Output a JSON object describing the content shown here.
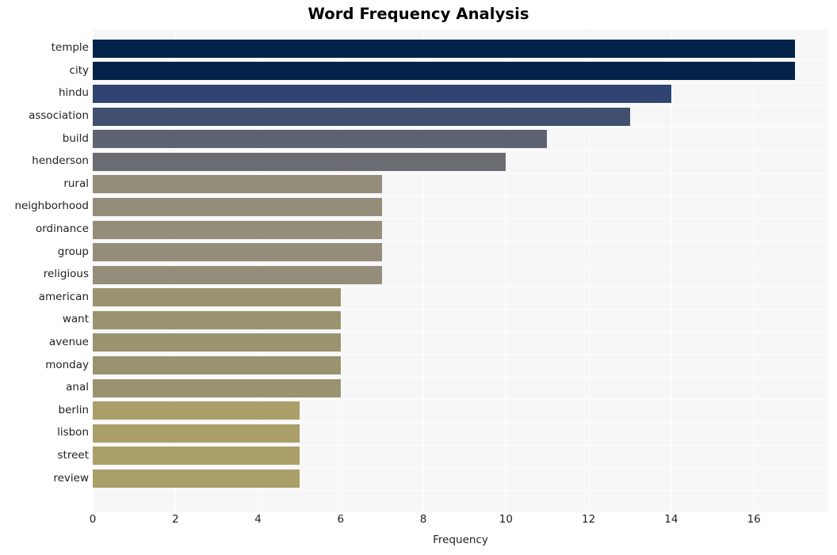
{
  "chart_data": {
    "type": "bar",
    "orientation": "horizontal",
    "title": "Word Frequency Analysis",
    "xlabel": "Frequency",
    "ylabel": "",
    "categories": [
      "temple",
      "city",
      "hindu",
      "association",
      "build",
      "henderson",
      "rural",
      "neighborhood",
      "ordinance",
      "group",
      "religious",
      "american",
      "want",
      "avenue",
      "monday",
      "anal",
      "berlin",
      "lisbon",
      "street",
      "review"
    ],
    "values": [
      17,
      17,
      14,
      13,
      11,
      10,
      7,
      7,
      7,
      7,
      7,
      6,
      6,
      6,
      6,
      6,
      5,
      5,
      5,
      5
    ],
    "bar_colors": [
      "#04234a",
      "#04234a",
      "#2f4470",
      "#41506e",
      "#5e6273",
      "#6b6b72",
      "#938d79",
      "#938d79",
      "#938d79",
      "#938d79",
      "#938d79",
      "#9a9370",
      "#9a9370",
      "#9a9370",
      "#9a9370",
      "#9a9370",
      "#aa9f68",
      "#aa9f68",
      "#aa9f68",
      "#aa9f68"
    ],
    "xlim": [
      0,
      17.8
    ],
    "xticks": [
      0,
      2,
      4,
      6,
      8,
      10,
      12,
      14,
      16
    ],
    "xtick_labels": [
      "0",
      "2",
      "4",
      "6",
      "8",
      "10",
      "12",
      "14",
      "16"
    ],
    "grid": true,
    "grid_color": "#ffffff",
    "plot_background": "#f7f7f8",
    "figure_background": "#ffffff",
    "legend": null,
    "title_color": "#000000",
    "tick_color": "#222222"
  }
}
